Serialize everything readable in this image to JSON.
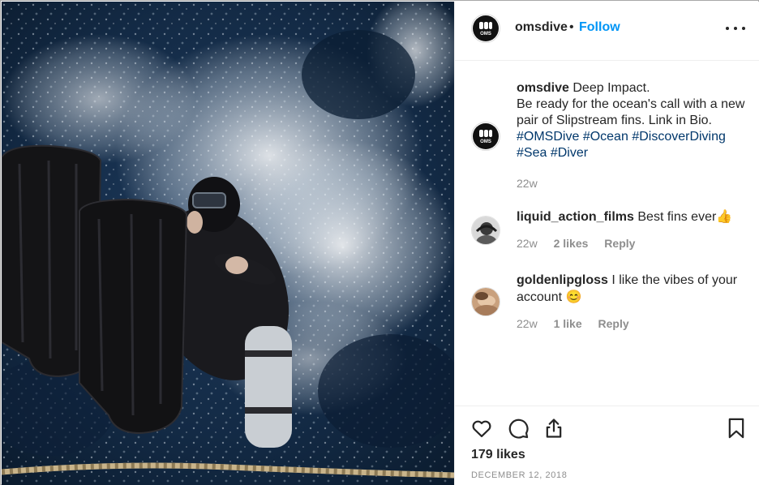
{
  "post": {
    "username": "omsdive",
    "dot": "•",
    "follow_label": "Follow",
    "avatar_text": "OMS",
    "more_icon": "more-horizontal-icon"
  },
  "caption": {
    "username": "omsdive",
    "line1": "Deep Impact.",
    "line2": "Be ready for the ocean's call with a new pair of Slipstream fins. Link in Bio.",
    "hashtags": [
      "#OMSDive",
      "#Ocean",
      "#DiscoverDiving",
      "#Sea",
      "#Diver"
    ],
    "time": "22w"
  },
  "comments": [
    {
      "username": "liquid_action_films",
      "text": "Best fins ever👍",
      "time": "22w",
      "likes": "2 likes",
      "reply": "Reply"
    },
    {
      "username": "goldenlipgloss",
      "text": "I like the vibes of your account 😊",
      "time": "22w",
      "likes": "1 like",
      "reply": "Reply"
    }
  ],
  "actions": {
    "like_icon": "heart-icon",
    "comment_icon": "comment-icon",
    "share_icon": "share-icon",
    "save_icon": "bookmark-icon",
    "likes": "179 likes",
    "date": "DECEMBER 12, 2018"
  },
  "colors": {
    "accent": "#0095f6",
    "hashtag": "#00376b",
    "muted": "#8e8e8e",
    "text": "#262626"
  }
}
